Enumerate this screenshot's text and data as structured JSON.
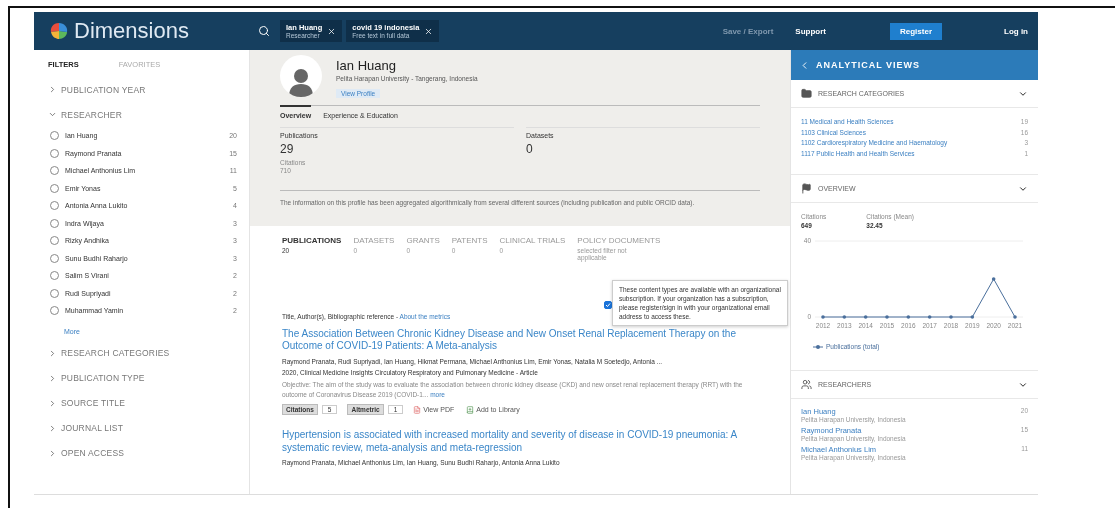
{
  "header": {
    "logo": "Dimensions",
    "search_tags": [
      {
        "label": "Ian Huang",
        "sub": "Researcher"
      },
      {
        "label": "covid 19 indonesia",
        "sub": "Free text in full data"
      }
    ],
    "save_export": {
      "label": "Save / Export",
      "disabled": true
    },
    "support": "Support",
    "register": "Register",
    "login": "Log in"
  },
  "sidebar": {
    "tabs": [
      {
        "label": "FILTERS",
        "selected": true
      },
      {
        "label": "FAVORITES",
        "selected": false
      }
    ],
    "sections": [
      {
        "label": "PUBLICATION YEAR",
        "expanded": false
      },
      {
        "label": "RESEARCHER",
        "expanded": true,
        "more": "More",
        "items": [
          {
            "name": "Ian Huang",
            "count": "20",
            "checked": false
          },
          {
            "name": "Raymond Pranata",
            "count": "15",
            "checked": false
          },
          {
            "name": "Michael Anthonius Lim",
            "count": "11",
            "checked": false
          },
          {
            "name": "Emir Yonas",
            "count": "5",
            "checked": false
          },
          {
            "name": "Antonia Anna Lukito",
            "count": "4",
            "checked": false
          },
          {
            "name": "Indra Wijaya",
            "count": "3",
            "checked": false
          },
          {
            "name": "Rizky Andhika",
            "count": "3",
            "checked": false
          },
          {
            "name": "Sunu Budhi Raharjo",
            "count": "3",
            "checked": false
          },
          {
            "name": "Salim S Virani",
            "count": "2",
            "checked": false
          },
          {
            "name": "Rudi Supriyadi",
            "count": "2",
            "checked": false
          },
          {
            "name": "Muhammad Yamin",
            "count": "2",
            "checked": false
          }
        ]
      },
      {
        "label": "RESEARCH CATEGORIES",
        "expanded": false
      },
      {
        "label": "PUBLICATION TYPE",
        "expanded": false
      },
      {
        "label": "SOURCE TITLE",
        "expanded": false
      },
      {
        "label": "JOURNAL LIST",
        "expanded": false
      },
      {
        "label": "OPEN ACCESS",
        "expanded": false
      }
    ]
  },
  "profile": {
    "name": "Ian Huang",
    "affiliation": "Pelita Harapan University - Tangerang, Indonesia",
    "view_profile": "View Profile",
    "tabs": [
      {
        "label": "Overview",
        "selected": true
      },
      {
        "label": "Experience & Education",
        "selected": false
      }
    ],
    "stats": [
      {
        "label": "Publications",
        "value": "29",
        "sub_label": "Citations",
        "sub_value": "710"
      },
      {
        "label": "Datasets",
        "value": "0"
      }
    ],
    "note": "The information on this profile has been aggregated algorithmically from several different sources (including publication and public ORCID data)."
  },
  "results": {
    "tabs": [
      {
        "label": "PUBLICATIONS",
        "count": "20",
        "selected": true
      },
      {
        "label": "DATASETS",
        "count": "0",
        "selected": false
      },
      {
        "label": "GRANTS",
        "count": "0",
        "selected": false
      },
      {
        "label": "PATENTS",
        "count": "0",
        "selected": false
      },
      {
        "label": "CLINICAL TRIALS",
        "count": "0",
        "selected": false
      },
      {
        "label": "POLICY DOCUMENTS",
        "note": "selected filter not applicable",
        "selected": false
      }
    ],
    "checkbox_checked": true,
    "tooltip": "These content types are available with an organizational subscription. If your organization has a subscription, please register/sign in with your organizational email address to access these.",
    "list_header": "Title, Author(s), Bibliographic reference - ",
    "metrics_link": "About the metrics",
    "items": [
      {
        "title": "The Association Between Chronic Kidney Disease and New Onset Renal Replacement Therapy on the Outcome of COVID-19 Patients: A Meta-analysis",
        "authors": "Raymond Pranata, Rudi Supriyadi, Ian Huang, Hikmat Permana, Michael Anthonius Lim, Emir Yonas, Natalia M Soetedjo, Antonia ...",
        "source": "2020, Clinical Medicine Insights Circulatory Respiratory and Pulmonary Medicine - Article",
        "abstract": "Objective: The aim of the study was to evaluate the association between chronic kidney disease (CKD) and new onset renal replacement therapy (RRT) with the outcome of Coronavirus Disease 2019 (COVID-1...",
        "more": "more",
        "badges": [
          {
            "label": "Citations",
            "count": "5"
          },
          {
            "label": "Altmetric",
            "count": "1"
          }
        ],
        "actions": [
          {
            "kind": "pdf",
            "label": "View PDF"
          },
          {
            "kind": "library",
            "label": "Add to Library"
          }
        ]
      },
      {
        "title": "Hypertension is associated with increased mortality and severity of disease in COVID-19 pneumonia: A systematic review, meta-analysis and meta-regression",
        "authors": "Raymond Pranata, Michael Anthonius Lim, Ian Huang, Sunu Budhi Raharjo, Antonia Anna Lukito"
      }
    ]
  },
  "analytics": {
    "title": "ANALYTICAL VIEWS",
    "categories": {
      "title": "RESEARCH CATEGORIES",
      "items": [
        {
          "label": "11 Medical and Health Sciences",
          "count": "19"
        },
        {
          "label": "1103 Clinical Sciences",
          "count": "16"
        },
        {
          "label": "1102 Cardiorespiratory Medicine and Haematology",
          "count": "3"
        },
        {
          "label": "1117 Public Health and Health Services",
          "count": "1"
        }
      ]
    },
    "overview": {
      "title": "OVERVIEW",
      "stats": [
        {
          "label": "Citations",
          "value": "649"
        },
        {
          "label": "Citations (Mean)",
          "value": "32.45"
        }
      ],
      "chart_data": {
        "type": "line",
        "categories": [
          "2012",
          "2013",
          "2014",
          "2015",
          "2016",
          "2017",
          "2018",
          "2019",
          "2020",
          "2021"
        ],
        "series": [
          {
            "name": "Publications (total)",
            "color": "#4a6f9c",
            "values": [
              0,
              0,
              0,
              0,
              0,
              0,
              0,
              0,
              20,
              0
            ]
          }
        ],
        "ylim": [
          0,
          40
        ],
        "yticks": [
          0,
          40
        ]
      }
    },
    "researchers": {
      "title": "RESEARCHERS",
      "items": [
        {
          "name": "Ian Huang",
          "affiliation": "Pelita Harapan University, Indonesia",
          "count": "20"
        },
        {
          "name": "Raymond Pranata",
          "affiliation": "Pelita Harapan University, Indonesia",
          "count": "15"
        },
        {
          "name": "Michael Anthonius Lim",
          "affiliation": "Pelita Harapan University, Indonesia",
          "count": "11"
        }
      ]
    }
  }
}
